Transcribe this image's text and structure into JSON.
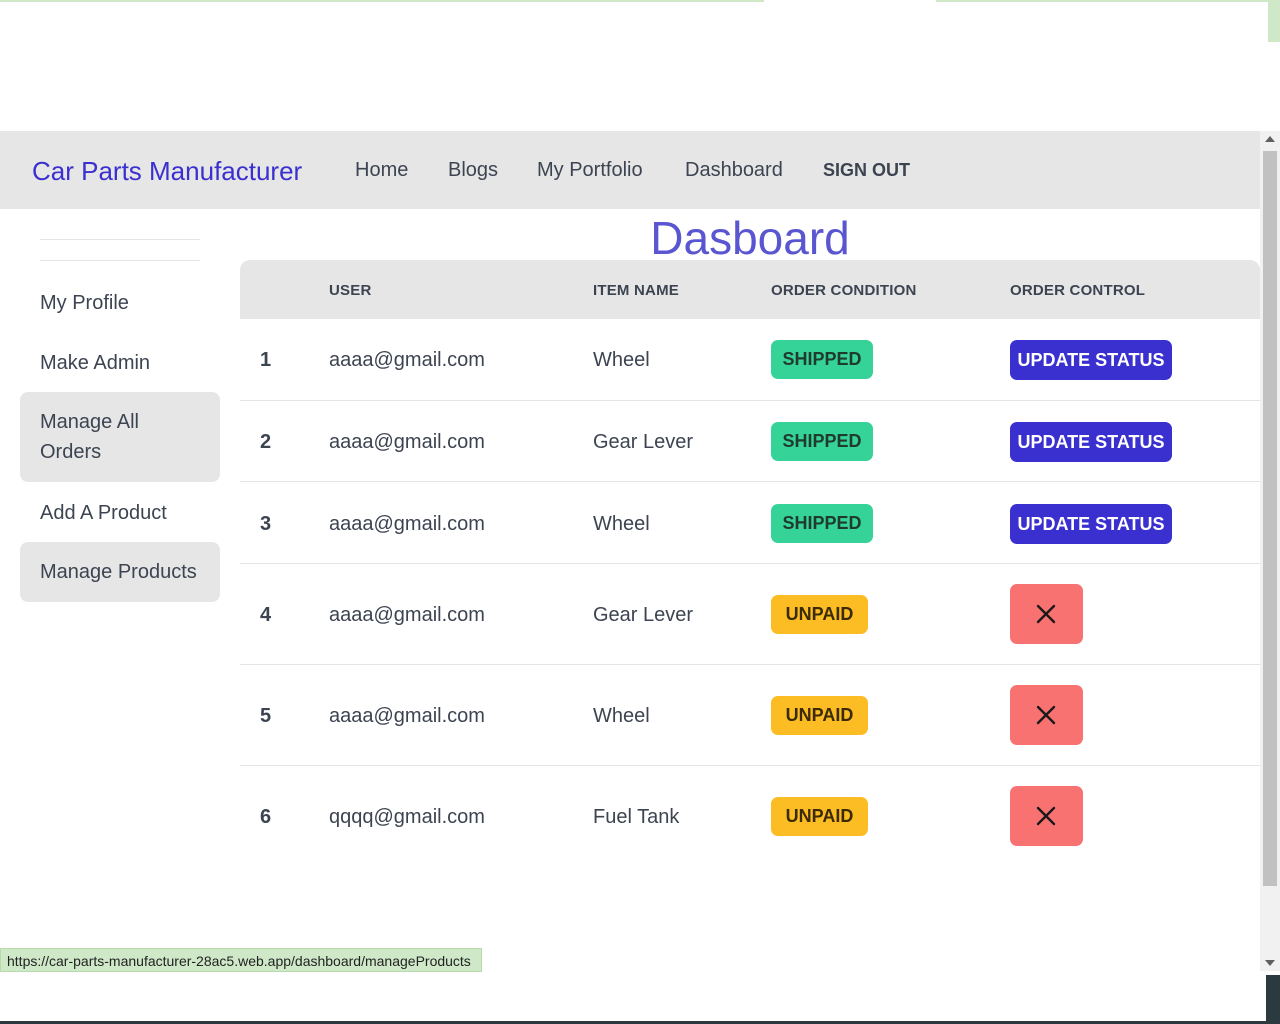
{
  "navbar": {
    "brand": "Car Parts Manufacturer",
    "links": [
      "Home",
      "Blogs",
      "My Portfolio",
      "Dashboard"
    ],
    "signout": "SIGN OUT"
  },
  "sidebar": {
    "items": [
      {
        "label": "My Profile",
        "active": false
      },
      {
        "label": "Make Admin",
        "active": false
      },
      {
        "label": "Manage All Orders",
        "active": true
      },
      {
        "label": "Add A Product",
        "active": false
      },
      {
        "label": "Manage Products",
        "active": true
      }
    ]
  },
  "main": {
    "title": "Dasboard"
  },
  "table": {
    "headers": [
      "USER",
      "ITEM NAME",
      "ORDER CONDITION",
      "ORDER CONTROL"
    ],
    "rows": [
      {
        "num": "1",
        "user": "aaaa@gmail.com",
        "item": "Wheel",
        "condition": "SHIPPED",
        "control": "UPDATE STATUS"
      },
      {
        "num": "2",
        "user": "aaaa@gmail.com",
        "item": "Gear Lever",
        "condition": "SHIPPED",
        "control": "UPDATE STATUS"
      },
      {
        "num": "3",
        "user": "aaaa@gmail.com",
        "item": "Wheel",
        "condition": "SHIPPED",
        "control": "UPDATE STATUS"
      },
      {
        "num": "4",
        "user": "aaaa@gmail.com",
        "item": "Gear Lever",
        "condition": "UNPAID",
        "control": "close-icon"
      },
      {
        "num": "5",
        "user": "aaaa@gmail.com",
        "item": "Wheel",
        "condition": "UNPAID",
        "control": "close-icon"
      },
      {
        "num": "6",
        "user": "qqqq@gmail.com",
        "item": "Fuel Tank",
        "condition": "UNPAID",
        "control": "close-icon"
      }
    ]
  },
  "statusbar": {
    "url": "https://car-parts-manufacturer-28ac5.web.app/dashboard/manageProducts"
  },
  "colors": {
    "brand": "#3a2fcf",
    "title": "#5a55d0",
    "shipped": "#36d399",
    "unpaid": "#fbbd23",
    "cancel": "#f87272",
    "nav_bg": "#e6e6e6"
  }
}
